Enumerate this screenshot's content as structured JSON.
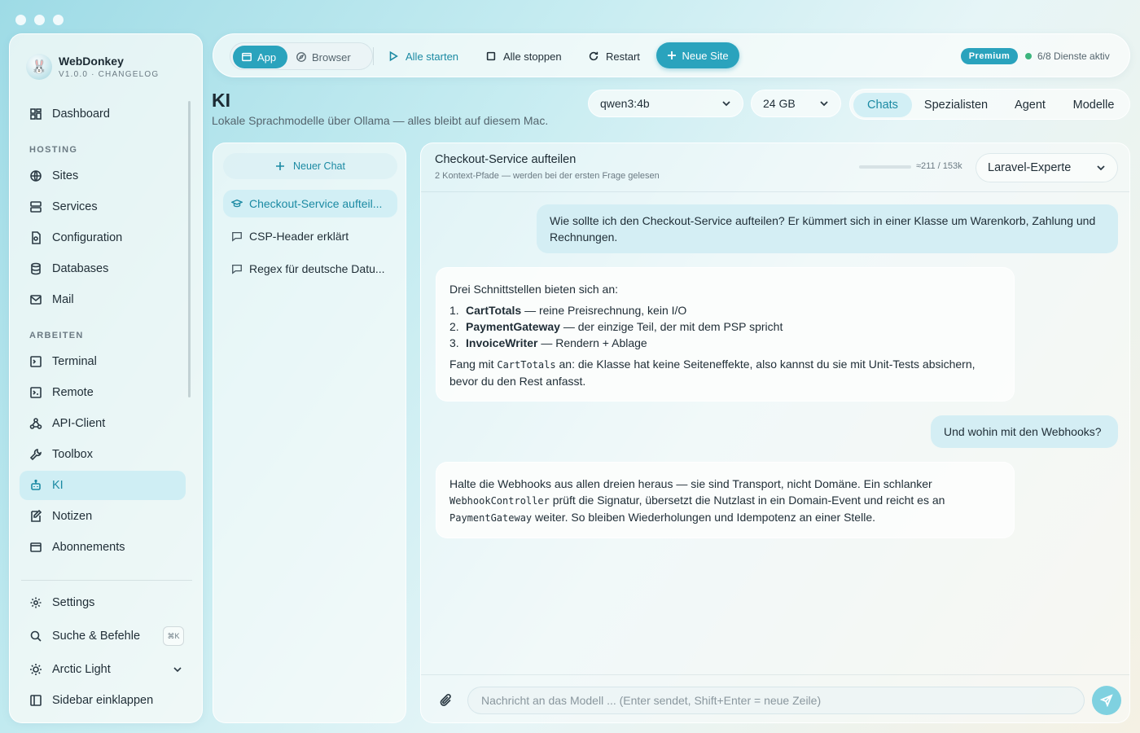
{
  "window": {
    "title": "WebDonkey"
  },
  "brand": {
    "name": "WebDonkey",
    "version_line": "V1.0.0 · CHANGELOG",
    "logo_glyph": "🐰"
  },
  "sidebar": {
    "dashboard": "Dashboard",
    "section_hosting": "HOSTING",
    "hosting": [
      "Sites",
      "Services",
      "Configuration",
      "Databases",
      "Mail"
    ],
    "section_work": "ARBEITEN",
    "work": [
      "Terminal",
      "Remote",
      "API-Client",
      "Toolbox",
      "KI",
      "Notizen",
      "Abonnements"
    ],
    "active": "KI",
    "settings": "Settings",
    "search": "Suche & Befehle",
    "search_shortcut": "⌘K",
    "theme": "Arctic Light",
    "collapse": "Sidebar einklappen"
  },
  "toolbar": {
    "mode_app": "App",
    "mode_browser": "Browser",
    "start_all": "Alle starten",
    "stop_all": "Alle stoppen",
    "restart": "Restart",
    "new_site": "Neue Site",
    "premium": "Premium",
    "services_status": "6/8 Dienste aktiv",
    "accent": "#2aa3bd"
  },
  "page": {
    "title": "KI",
    "subtitle": "Lokale Sprachmodelle über Ollama — alles bleibt auf diesem Mac.",
    "model_select": "qwen3:4b",
    "memory_select": "24 GB",
    "tabs": [
      "Chats",
      "Spezialisten",
      "Agent",
      "Modelle"
    ],
    "active_tab": "Chats"
  },
  "chats": {
    "new_chat": "Neuer Chat",
    "items": [
      "Checkout-Service aufteil...",
      "CSP-Header erklärt",
      "Regex für deutsche Datu..."
    ]
  },
  "conversation": {
    "title": "Checkout-Service aufteilen",
    "subtitle": "2 Kontext-Pfade — werden bei der ersten Frage gelesen",
    "context_usage": "≈211 / 153k",
    "persona": "Laravel-Experte",
    "messages": {
      "user1": "Wie sollte ich den Checkout-Service aufteilen? Er kümmert sich in einer Klasse um Warenkorb, Zahlung und Rechnungen.",
      "ai1": {
        "intro": "Drei Schnittstellen bieten sich an:",
        "items": [
          {
            "num": "1.",
            "name": "CartTotals",
            "desc": " — reine Preisrechnung, kein I/O"
          },
          {
            "num": "2.",
            "name": "PaymentGateway",
            "desc": " — der einzige Teil, der mit dem PSP spricht"
          },
          {
            "num": "3.",
            "name": "InvoiceWriter",
            "desc": " — Rendern + Ablage"
          }
        ],
        "outro_pre": "Fang mit ",
        "outro_code": "CartTotals",
        "outro_post": " an: die Klasse hat keine Seiteneffekte, also kannst du sie mit Unit-Tests absichern, bevor du den Rest anfasst."
      },
      "user2": "Und wohin mit den Webhooks?",
      "ai2": {
        "p1": "Halte die Webhooks aus allen dreien heraus — sie sind Transport, nicht Domäne. Ein schlanker ",
        "code1": "WebhookController",
        "p2": " prüft die Signatur, übersetzt die Nutzlast in ein Domain-Event und reicht es an ",
        "code2": "PaymentGateway",
        "p3": " weiter. So bleiben Wiederholungen und Idempotenz an einer Stelle."
      }
    },
    "input_placeholder": "Nachricht an das Modell ... (Enter sendet, Shift+Enter = neue Zeile)"
  }
}
